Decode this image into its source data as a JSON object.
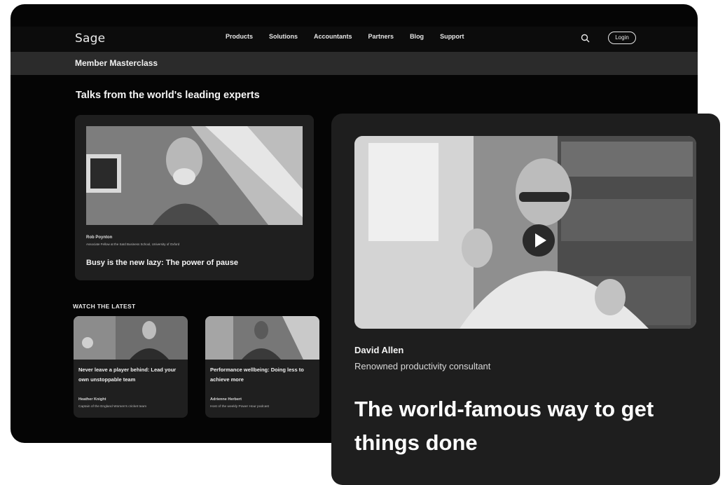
{
  "header": {
    "logo_text": "Sage",
    "nav": [
      "Products",
      "Solutions",
      "Accountants",
      "Partners",
      "Blog",
      "Support"
    ],
    "login_label": "Login",
    "search_icon": "search-icon"
  },
  "subheader": {
    "title": "Member Masterclass"
  },
  "main": {
    "section_title": "Talks from the world's leading experts",
    "featured": {
      "speaker_name": "Rob Poynton",
      "speaker_role": "Associate Fellow at the Saïd Business School, University of Oxford",
      "title": "Busy is the new lazy: The power of pause"
    },
    "watch_latest_label": "WATCH THE LATEST",
    "latest": [
      {
        "title": "Never leave a player behind: Lead your own unstoppable team",
        "speaker_name": "Heather Knight",
        "speaker_role": "Captain of the England Women's cricket team"
      },
      {
        "title": "Performance wellbeing: Doing less to achieve more",
        "speaker_name": "Adrienne Herbert",
        "speaker_role": "Host of the weekly Power Hour podcast"
      }
    ]
  },
  "front_card": {
    "speaker_name": "David Allen",
    "speaker_role": "Renowned productivity consultant",
    "title": "The world-famous way to get things done",
    "play_icon": "play-icon"
  }
}
